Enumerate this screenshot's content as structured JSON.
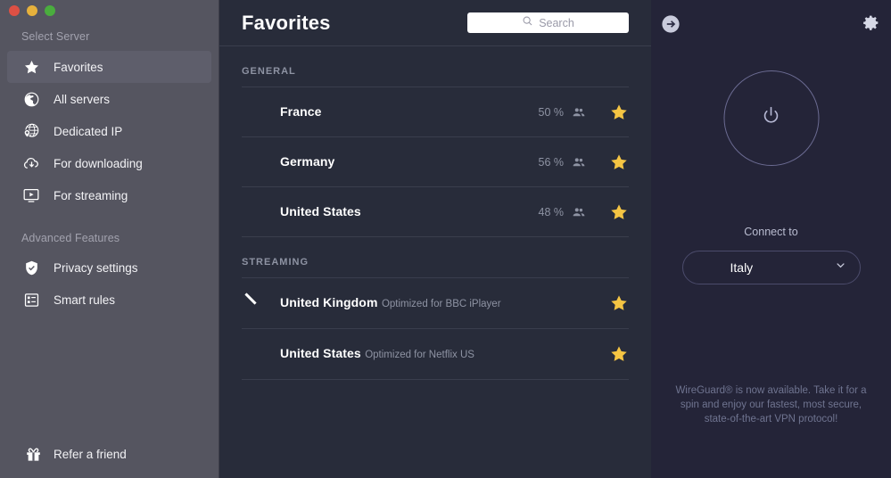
{
  "window": {
    "traffic_lights": [
      "close",
      "minimize",
      "zoom"
    ],
    "colors": {
      "sidebar_bg": "#555560",
      "main_bg": "#282c3a",
      "right_bg": "#242438",
      "star": "#f5c543",
      "accent": "#6b6b92"
    }
  },
  "sidebar": {
    "section_select_server": "Select Server",
    "section_advanced": "Advanced Features",
    "items": [
      {
        "label": "Favorites",
        "icon": "star-icon",
        "active": true
      },
      {
        "label": "All servers",
        "icon": "globe-icon",
        "active": false
      },
      {
        "label": "Dedicated IP",
        "icon": "globe-pin-icon",
        "active": false
      },
      {
        "label": "For downloading",
        "icon": "cloud-download-icon",
        "active": false
      },
      {
        "label": "For streaming",
        "icon": "monitor-play-icon",
        "active": false
      }
    ],
    "advanced_items": [
      {
        "label": "Privacy settings",
        "icon": "shield-check-icon",
        "active": false
      },
      {
        "label": "Smart rules",
        "icon": "list-card-icon",
        "active": false
      }
    ],
    "refer": {
      "label": "Refer a friend",
      "icon": "gift-icon"
    }
  },
  "main": {
    "title": "Favorites",
    "search": {
      "placeholder": "Search",
      "value": "",
      "icon": "search-icon"
    },
    "groups": [
      {
        "label": "GENERAL",
        "rows": [
          {
            "name": "France",
            "subtitle": "",
            "load": "50 %",
            "flag": "fr",
            "users_icon": "users-icon",
            "favorite": true
          },
          {
            "name": "Germany",
            "subtitle": "",
            "load": "56 %",
            "flag": "de",
            "users_icon": "users-icon",
            "favorite": true
          },
          {
            "name": "United States",
            "subtitle": "",
            "load": "48 %",
            "flag": "us",
            "users_icon": "users-icon",
            "favorite": true
          }
        ]
      },
      {
        "label": "STREAMING",
        "rows": [
          {
            "name": "United Kingdom",
            "subtitle": "Optimized for BBC iPlayer",
            "load": "",
            "flag": "uk",
            "users_icon": "",
            "favorite": true
          },
          {
            "name": "United States",
            "subtitle": "Optimized for Netflix US",
            "load": "",
            "flag": "us",
            "users_icon": "",
            "favorite": true
          }
        ]
      }
    ]
  },
  "right_panel": {
    "collapse_icon": "arrow-right-circle-icon",
    "settings_icon": "gear-icon",
    "power_icon": "power-icon",
    "connect_to_label": "Connect to",
    "selected_country": {
      "label": "Italy",
      "flag": "it",
      "chevron_icon": "chevron-down-icon"
    },
    "footer_note": "WireGuard® is now available. Take it for a spin and enjoy our fastest, most secure, state-of-the-art VPN protocol!"
  }
}
